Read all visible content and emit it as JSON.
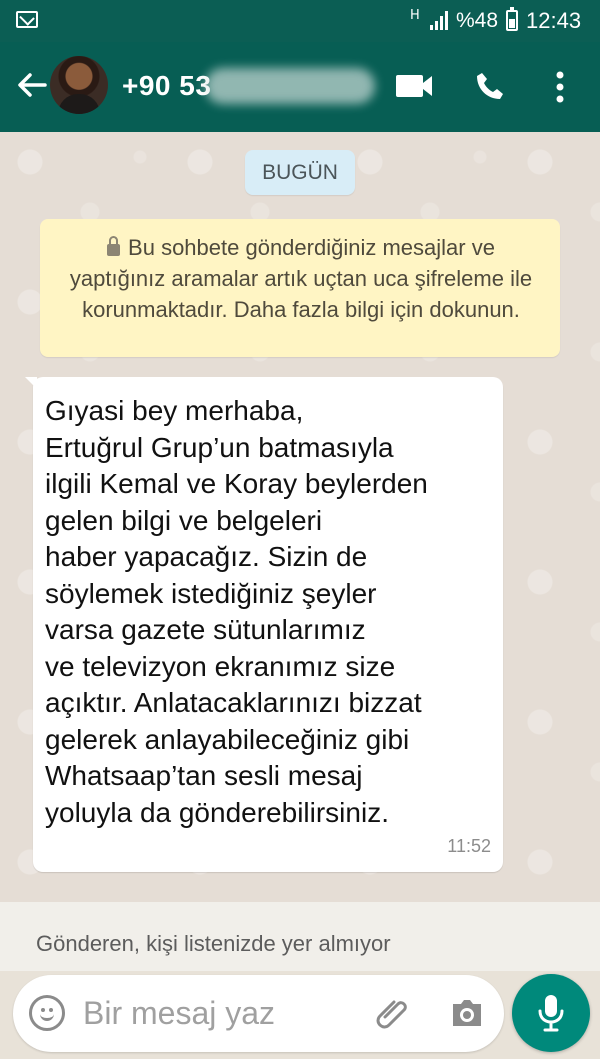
{
  "status_bar": {
    "network": "H",
    "battery": "%48",
    "time": "12:43"
  },
  "header": {
    "contact": "+90 53",
    "icons": [
      "back-arrow-icon",
      "video-call-icon",
      "phone-icon",
      "more-vert-icon"
    ]
  },
  "chat": {
    "date_label": "BUGÜN",
    "encryption_notice": "Bu sohbete gönderdiğiniz mesajlar ve yaptığınız aramalar artık uçtan uca şifreleme ile korunmaktadır. Daha fazla bilgi için dokunun.",
    "messages": [
      {
        "text": "Gıyasi bey merhaba,\nErtuğrul Grup’un batmasıyla\nilgili Kemal ve Koray beylerden\ngelen bilgi ve belgeleri\nhaber yapacağız. Sizin de\nsöylemek istediğiniz şeyler\nvarsa gazete sütunlarımız\nve televizyon ekranımız size\naçıktır. Anlatacaklarınızı bizzat\ngelerek anlayabileceğiniz gibi\nWhatsaap’tan sesli mesaj\nyoluyla da gönderebilirsiniz.",
        "time": "11:52"
      }
    ],
    "sender_notice": "Gönderen, kişi listenizde yer almıyor"
  },
  "composer": {
    "placeholder": "Bir mesaj yaz",
    "icons": [
      "emoji-icon",
      "attachment-icon",
      "camera-icon",
      "microphone-icon"
    ]
  },
  "colors": {
    "header": "#075e54",
    "status_bar": "#0b5e54",
    "notice_background": "#fff5c4",
    "date_background": "#d8edf7",
    "message_background": "#ffffff",
    "mic_button": "#00897b"
  }
}
